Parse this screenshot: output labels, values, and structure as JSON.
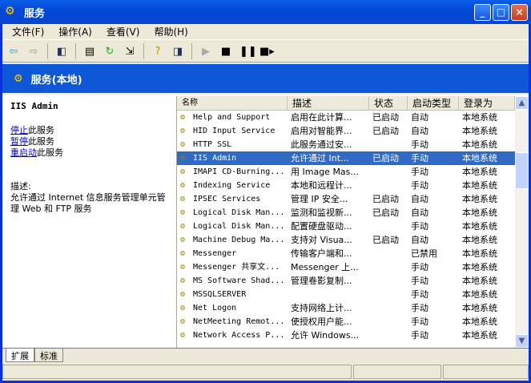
{
  "window": {
    "title": "服务",
    "minimize": "_",
    "maximize": "□",
    "close": "×"
  },
  "menu": [
    "文件(F)",
    "操作(A)",
    "查看(V)",
    "帮助(H)"
  ],
  "band_title": "服务(本地)",
  "left": {
    "service_name": "IIS Admin",
    "actions": [
      {
        "link": "停止",
        "rest": "此服务"
      },
      {
        "link": "暂停",
        "rest": "此服务"
      },
      {
        "link": "重启动",
        "rest": "此服务"
      }
    ],
    "desc_label": "描述:",
    "desc": "允许通过 Internet 信息服务管理单元管理 Web 和 FTP 服务"
  },
  "columns": [
    "名称",
    "描述",
    "状态",
    "启动类型",
    "登录为"
  ],
  "rows": [
    [
      "Help and Support",
      "启用在此计算...",
      "已启动",
      "自动",
      "本地系统"
    ],
    [
      "HID Input Service",
      "启用对智能界...",
      "已启动",
      "自动",
      "本地系统"
    ],
    [
      "HTTP SSL",
      "此服务通过安...",
      "",
      "手动",
      "本地系统"
    ],
    [
      "IIS Admin",
      "允许通过 Int...",
      "已启动",
      "手动",
      "本地系统"
    ],
    [
      "IMAPI CD-Burning...",
      "用 Image Mas...",
      "",
      "手动",
      "本地系统"
    ],
    [
      "Indexing Service",
      "本地和远程计...",
      "",
      "手动",
      "本地系统"
    ],
    [
      "IPSEC Services",
      "管理 IP 安全...",
      "已启动",
      "自动",
      "本地系统"
    ],
    [
      "Logical Disk Man...",
      "监测和监视新...",
      "已启动",
      "自动",
      "本地系统"
    ],
    [
      "Logical Disk Man...",
      "配置硬盘驱动...",
      "",
      "手动",
      "本地系统"
    ],
    [
      "Machine Debug Ma...",
      "支持对 Visua...",
      "已启动",
      "自动",
      "本地系统"
    ],
    [
      "Messenger",
      "传输客户端和...",
      "",
      "已禁用",
      "本地系统"
    ],
    [
      "Messenger 共享文...",
      "Messenger 上...",
      "",
      "手动",
      "本地系统"
    ],
    [
      "MS Software Shad...",
      "管理卷影复制...",
      "",
      "手动",
      "本地系统"
    ],
    [
      "MSSQLSERVER",
      "",
      "",
      "手动",
      "本地系统"
    ],
    [
      "Net Logon",
      "支持网络上计...",
      "",
      "手动",
      "本地系统"
    ],
    [
      "NetMeeting Remot...",
      "使授权用户能...",
      "",
      "手动",
      "本地系统"
    ],
    [
      "Network Access P...",
      "允许 Windows...",
      "",
      "手动",
      "本地系统"
    ]
  ],
  "selected_index": 3,
  "tabs": [
    "扩展",
    "标准"
  ]
}
